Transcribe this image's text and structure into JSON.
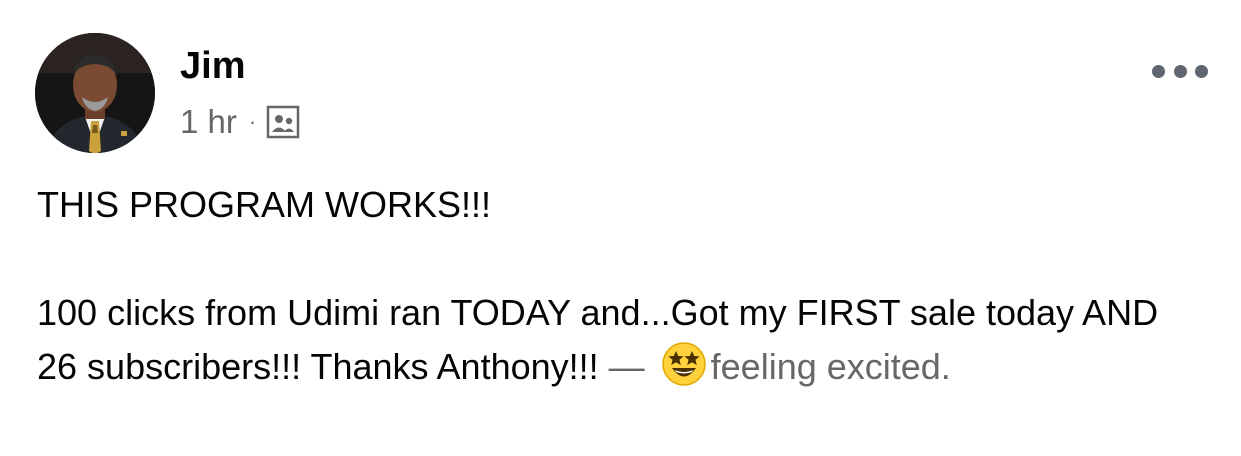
{
  "post": {
    "author": "Jim",
    "timestamp": "1 hr",
    "separator": "·",
    "audience_icon": "friends-photo-icon",
    "more_icon": "more-options-icon",
    "line1": "THIS PROGRAM WORKS!!!",
    "line2": "100 clicks from Udimi ran TODAY and...Got my FIRST sale today AND 26 subscribers!!! Thanks Anthony!!!",
    "dash": " — ",
    "feeling_emoji": "star-struck-emoji",
    "feeling_text": "feeling excited."
  },
  "colors": {
    "text": "#050505",
    "secondary": "#65676b",
    "dots": "#606770",
    "emoji": "#ffd23c"
  }
}
